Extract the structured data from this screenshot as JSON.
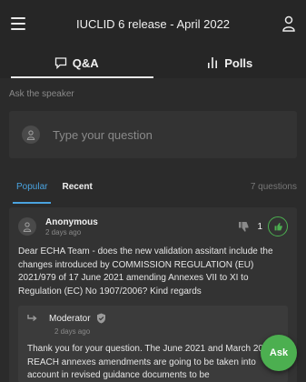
{
  "header": {
    "title": "IUCLID 6 release - April 2022"
  },
  "tabs": [
    {
      "label": "Q&A",
      "icon": "chat-icon",
      "active": true
    },
    {
      "label": "Polls",
      "icon": "bar-chart-icon",
      "active": false
    }
  ],
  "ask": {
    "label": "Ask the speaker",
    "placeholder": "Type your question"
  },
  "filter": {
    "popular": "Popular",
    "recent": "Recent",
    "count": "7 questions"
  },
  "question": {
    "author": "Anonymous",
    "time": "2 days ago",
    "votes": "1",
    "text": "Dear ECHA Team - does the new validation assitant include the changes introduced by COMMISSION REGULATION (EU) 2021/979 of 17 June 2021 amending Annexes VII to XI to Regulation (EC) No 1907/2006? Kind regards"
  },
  "answer": {
    "author": "Moderator",
    "time": "2 days ago",
    "text": "Thank you for your question. The June 2021 and March 2022 REACH annexes amendments are going to be taken into account in revised guidance documents to be"
  },
  "fab": {
    "label": "Ask"
  },
  "colors": {
    "accent": "#4aa3df",
    "green": "#4caf50",
    "background": "#2b2b2b"
  }
}
